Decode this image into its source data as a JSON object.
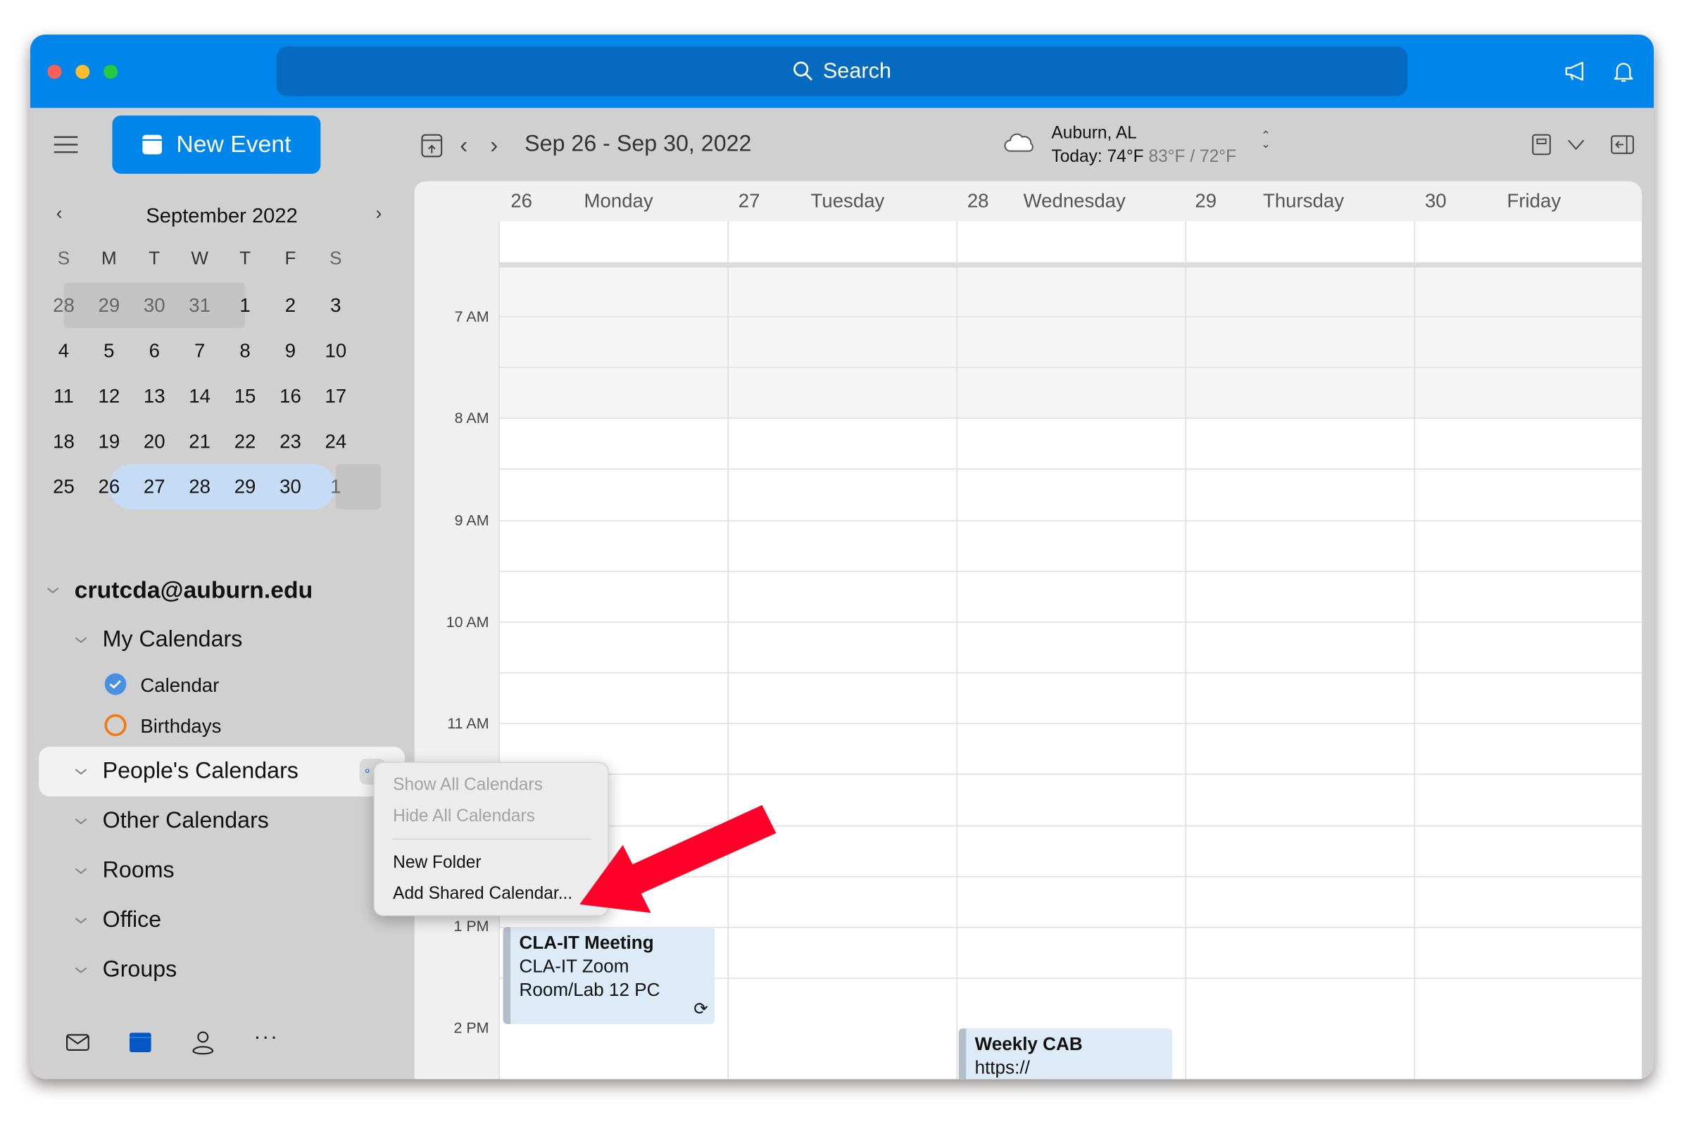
{
  "titlebar": {
    "search_label": "Search",
    "icons": [
      "megaphone-icon",
      "bell-icon"
    ]
  },
  "sidebar": {
    "new_event_label": "New Event",
    "mini_calendar": {
      "month_label": "September 2022",
      "weekdays": [
        "S",
        "M",
        "T",
        "W",
        "T",
        "F",
        "S"
      ],
      "weeks": [
        [
          "28",
          "29",
          "30",
          "31",
          "1",
          "2",
          "3"
        ],
        [
          "4",
          "5",
          "6",
          "7",
          "8",
          "9",
          "10"
        ],
        [
          "11",
          "12",
          "13",
          "14",
          "15",
          "16",
          "17"
        ],
        [
          "18",
          "19",
          "20",
          "21",
          "22",
          "23",
          "24"
        ],
        [
          "25",
          "26",
          "27",
          "28",
          "29",
          "30",
          "1"
        ]
      ],
      "selected_range": [
        "26",
        "30"
      ]
    },
    "account": "crutcda@auburn.edu",
    "groups": {
      "my_calendars": "My Calendars",
      "calendar": "Calendar",
      "birthdays": "Birthdays",
      "peoples": "People's Calendars",
      "other": "Other Calendars",
      "rooms": "Rooms",
      "office": "Office",
      "groups": "Groups"
    },
    "colors": {
      "calendar": "#4A90E2",
      "birthdays": "#F07A10"
    },
    "bottom_nav": [
      "mail-icon",
      "calendar-icon",
      "people-icon",
      "more-icon"
    ]
  },
  "toolbar": {
    "date_range": "Sep 26 - Sep 30, 2022",
    "weather": {
      "location": "Auburn, AL",
      "today": "Today: 74°F",
      "range": "83°F / 72°F"
    }
  },
  "week": {
    "days": [
      {
        "num": "26",
        "name": "Monday"
      },
      {
        "num": "27",
        "name": "Tuesday"
      },
      {
        "num": "28",
        "name": "Wednesday"
      },
      {
        "num": "29",
        "name": "Thursday"
      },
      {
        "num": "30",
        "name": "Friday"
      }
    ],
    "hours": [
      "7 AM",
      "8 AM",
      "9 AM",
      "10 AM",
      "11 AM",
      "1 PM",
      "2 PM"
    ],
    "events": [
      {
        "title": "CLA-IT Meeting",
        "location": "CLA-IT Zoom Room/Lab 12 PC",
        "recurring": true
      },
      {
        "title": "Weekly CAB",
        "location": "https://"
      }
    ]
  },
  "context_menu": {
    "show_all": "Show All Calendars",
    "hide_all": "Hide All Calendars",
    "new_folder": "New Folder",
    "add_shared": "Add Shared Calendar..."
  },
  "accent_color": "#0086EA",
  "annotation_arrow_color": "#FF0028"
}
